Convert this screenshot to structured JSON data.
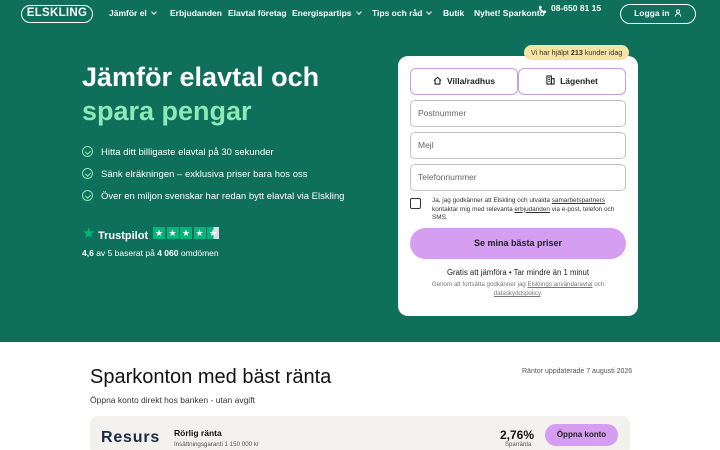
{
  "nav": {
    "logo": "ELSKLING",
    "items": [
      {
        "label": "Jämför el",
        "dropdown": true
      },
      {
        "label": "Erbjudanden",
        "dropdown": false
      },
      {
        "label": "Elavtal företag",
        "dropdown": false
      },
      {
        "label": "Energispartips",
        "dropdown": true
      },
      {
        "label": "Tips och råd",
        "dropdown": true
      },
      {
        "label": "Butik",
        "dropdown": false
      },
      {
        "label": "Nyhet! Sparkonto",
        "dropdown": false
      }
    ],
    "phone": "08-650 81 15",
    "login": "Logga in"
  },
  "hero": {
    "title_line1": "Jämför elavtal och",
    "title_line2": "spara pengar",
    "bullets": [
      "Hitta ditt billigaste elavtal på 30 sekunder",
      "Sänk elräkningen – exklusiva priser bara hos oss",
      "Över en miljon svenskar har redan bytt elavtal via Elskling"
    ],
    "trustpilot": {
      "name": "Trustpilot",
      "score": "4,6",
      "rating_pre": "av 5 baserat på",
      "review_count": "4 060",
      "rating_post": "omdömen",
      "stars": 4.5
    }
  },
  "form": {
    "badge_pre": "Vi har hjälpt",
    "badge_count": "213",
    "badge_post": "kunder idag",
    "type_villa": "Villa/radhus",
    "type_apartment": "Lägenhet",
    "postcode_placeholder": "Postnummer",
    "email_placeholder": "Mejl",
    "phone_placeholder": "Telefonnummer",
    "consent_a": "Ja, jag godkänner att Elskling och utvalda ",
    "consent_link1": "samarbetspartners",
    "consent_b": " kontaktar mig med relevanta ",
    "consent_link2": "erbjudanden",
    "consent_c": " via e-post, telefon och SMS.",
    "submit": "Se mina bästa priser",
    "free_text": "Gratis att jämföra  •  Tar mindre än 1 minut",
    "terms_a": "Genom att fortsätta godkänner jag ",
    "terms_link1": "Elsklings användaravtal",
    "terms_b": " och ",
    "terms_link2": "dataskyddspolicy",
    "terms_c": "."
  },
  "savings": {
    "title": "Sparkonton med bäst ränta",
    "updated": "Räntor uppdaterade 7 augusti 2026",
    "subtitle": "Öppna konto direkt hos banken - utan avgift",
    "bank_logo": "Resurs",
    "rate_type": "Rörlig ränta",
    "insurance": "Insättningsgaranti 1 150 000 kr",
    "rate": "2,76%",
    "rate_label": "Sparränta",
    "open_button": "Öppna konto"
  },
  "colors": {
    "hero_bg": "#0e6f5a",
    "accent_green": "#8ee8b7",
    "cta_purple": "#d59ef0",
    "trustpilot_green": "#00b67a",
    "badge_yellow": "#f5e3a2"
  }
}
